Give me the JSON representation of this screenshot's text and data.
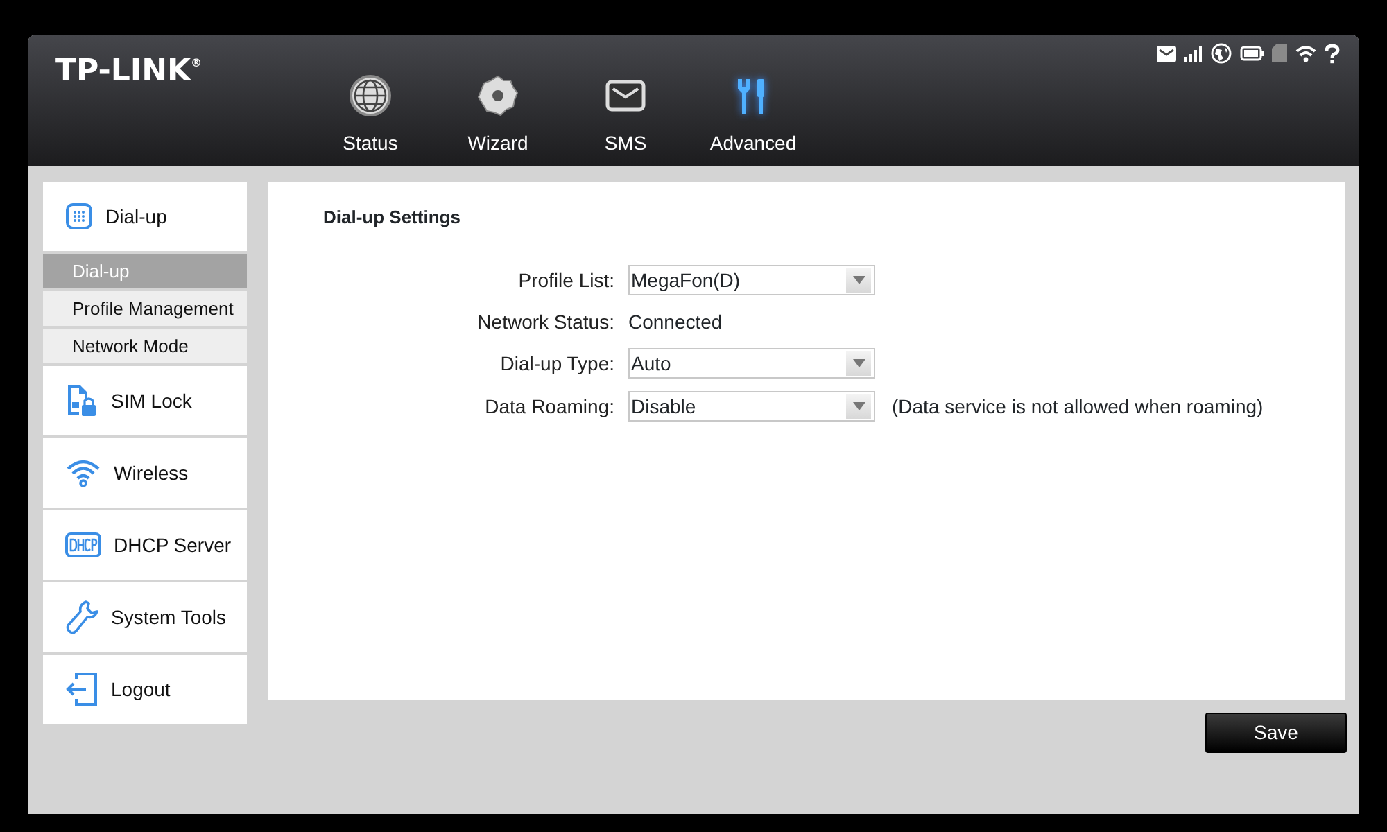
{
  "logo": "TP-LINK$^{®}$",
  "nav": [
    {
      "label": "Status",
      "selected": false
    },
    {
      "label": "Wizard",
      "selected": false
    },
    {
      "label": "SMS",
      "selected": false
    },
    {
      "label": "Advanced",
      "selected": true
    }
  ],
  "sidebar": [
    {
      "label": "Dial-up",
      "children": [
        {
          "label": "Dial-up",
          "selected": true
        },
        {
          "label": "Profile Management",
          "selected": false
        },
        {
          "label": "Network Mode",
          "selected": false
        }
      ]
    },
    {
      "label": "SIM Lock"
    },
    {
      "label": "Wireless"
    },
    {
      "label": "DHCP Server"
    },
    {
      "label": "System Tools"
    },
    {
      "label": "Logout"
    }
  ],
  "panel": {
    "title": "Dial-up Settings",
    "fields": [
      {
        "kind": "select",
        "label": "Profile List:",
        "value": "MegaFon(D)"
      },
      {
        "kind": "text",
        "label": "Network Status:",
        "value": "Connected"
      },
      {
        "kind": "select",
        "label": "Dial-up Type:",
        "value": "Auto"
      },
      {
        "kind": "select",
        "label": "Data Roaming:",
        "value": "Disable",
        "note": "(Data service is not allowed when roaming)"
      }
    ]
  },
  "save_button": "Save"
}
